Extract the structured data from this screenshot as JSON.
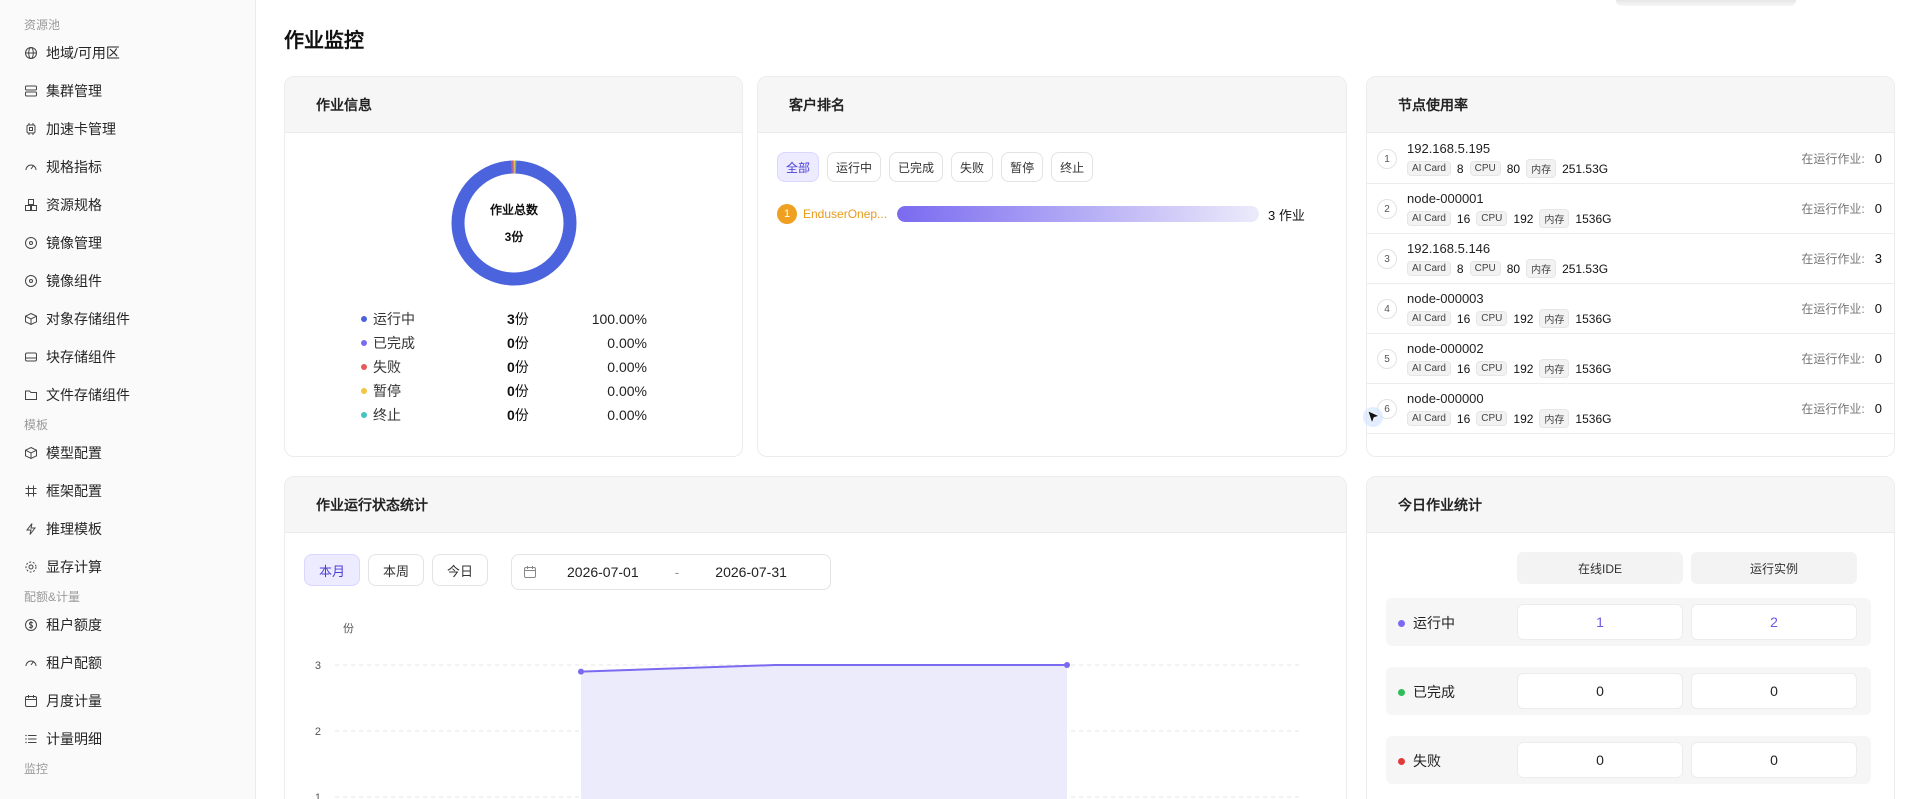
{
  "sidebar": {
    "groups": [
      {
        "label": "资源池",
        "items": [
          {
            "label": "地域/可用区",
            "icon": "globe-icon"
          },
          {
            "label": "集群管理",
            "icon": "server-icon"
          },
          {
            "label": "加速卡管理",
            "icon": "chip-icon"
          },
          {
            "label": "规格指标",
            "icon": "gauge-icon"
          },
          {
            "label": "资源规格",
            "icon": "cubes-icon"
          },
          {
            "label": "镜像管理",
            "icon": "disc-icon"
          },
          {
            "label": "镜像组件",
            "icon": "disc-icon"
          },
          {
            "label": "对象存储组件",
            "icon": "box-icon"
          },
          {
            "label": "块存储组件",
            "icon": "drive-icon"
          },
          {
            "label": "文件存储组件",
            "icon": "folder-icon"
          }
        ]
      },
      {
        "label": "模板",
        "items": [
          {
            "label": "模型配置",
            "icon": "box-icon"
          },
          {
            "label": "框架配置",
            "icon": "hash-icon"
          },
          {
            "label": "推理模板",
            "icon": "bolt-icon"
          },
          {
            "label": "显存计算",
            "icon": "gear-icon"
          }
        ]
      },
      {
        "label": "配额&计量",
        "items": [
          {
            "label": "租户额度",
            "icon": "dollar-icon"
          },
          {
            "label": "租户配额",
            "icon": "gauge-icon"
          },
          {
            "label": "月度计量",
            "icon": "calendar-icon"
          },
          {
            "label": "计量明细",
            "icon": "list-icon"
          }
        ]
      },
      {
        "label": "监控",
        "items": []
      }
    ]
  },
  "page": {
    "title": "作业监控"
  },
  "job_info": {
    "title": "作业信息",
    "total_label": "作业总数",
    "total_value": "3份",
    "legend": [
      {
        "name": "运行中",
        "count": "3",
        "unit": "份",
        "pct": "100.00%",
        "color": "#4b63dc",
        "share": 1.0
      },
      {
        "name": "已完成",
        "count": "0",
        "unit": "份",
        "pct": "0.00%",
        "color": "#7a6af0",
        "share": 0
      },
      {
        "name": "失败",
        "count": "0",
        "unit": "份",
        "pct": "0.00%",
        "color": "#e85a5a",
        "share": 0
      },
      {
        "name": "暂停",
        "count": "0",
        "unit": "份",
        "pct": "0.00%",
        "color": "#f4c542",
        "share": 0
      },
      {
        "name": "终止",
        "count": "0",
        "unit": "份",
        "pct": "0.00%",
        "color": "#45c2c2",
        "share": 0
      }
    ]
  },
  "ranking": {
    "title": "客户排名",
    "filters": [
      "全部",
      "运行中",
      "已完成",
      "失败",
      "暂停",
      "终止"
    ],
    "active_filter": "全部",
    "rows": [
      {
        "rank": "1",
        "name": "EnduserOnep...",
        "value": "3 作业",
        "share": 1.0
      }
    ]
  },
  "nodes": {
    "title": "节点使用率",
    "running_label": "在运行作业:",
    "tags": {
      "card": "AI Card",
      "cpu": "CPU",
      "mem": "内存"
    },
    "rows": [
      {
        "idx": "1",
        "name": "192.168.5.195",
        "card": "8",
        "cpu": "80",
        "mem": "251.53G",
        "running": "0"
      },
      {
        "idx": "2",
        "name": "node-000001",
        "card": "16",
        "cpu": "192",
        "mem": "1536G",
        "running": "0"
      },
      {
        "idx": "3",
        "name": "192.168.5.146",
        "card": "8",
        "cpu": "80",
        "mem": "251.53G",
        "running": "3"
      },
      {
        "idx": "4",
        "name": "node-000003",
        "card": "16",
        "cpu": "192",
        "mem": "1536G",
        "running": "0"
      },
      {
        "idx": "5",
        "name": "node-000002",
        "card": "16",
        "cpu": "192",
        "mem": "1536G",
        "running": "0"
      },
      {
        "idx": "6",
        "name": "node-000000",
        "card": "16",
        "cpu": "192",
        "mem": "1536G",
        "running": "0"
      }
    ]
  },
  "run_stats": {
    "title": "作业运行状态统计",
    "ranges": [
      "本月",
      "本周",
      "今日"
    ],
    "active_range": "本月",
    "date_start": "2026-07-01",
    "date_sep": "-",
    "date_end": "2026-07-31"
  },
  "chart_data": {
    "type": "area",
    "ylabel": "份",
    "yticks": [
      "1",
      "2",
      "3"
    ],
    "ylim": [
      0,
      3
    ],
    "series": [
      {
        "values": [
          2.9,
          3,
          3
        ],
        "color": "#7a6af0"
      }
    ]
  },
  "today_stats": {
    "title": "今日作业统计",
    "columns": [
      "在线IDE",
      "运行实例"
    ],
    "rows": [
      {
        "label": "运行中",
        "color": "#7a6af0",
        "values": [
          "1",
          "2"
        ],
        "highlight": true
      },
      {
        "label": "已完成",
        "color": "#2ebd59",
        "values": [
          "0",
          "0"
        ],
        "highlight": false
      },
      {
        "label": "失败",
        "color": "#e03b3b",
        "values": [
          "0",
          "0"
        ],
        "highlight": false
      }
    ]
  }
}
